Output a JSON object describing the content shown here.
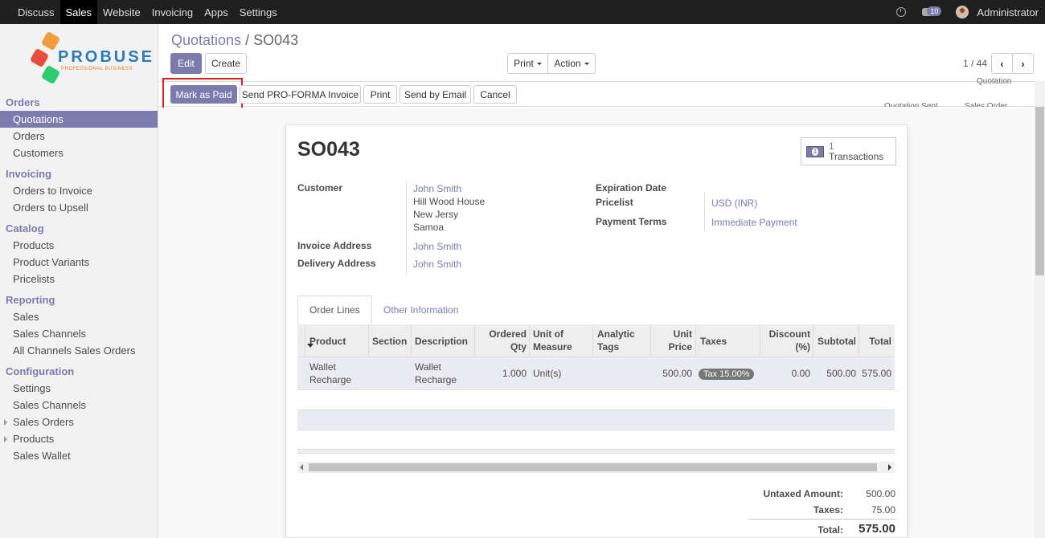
{
  "topbar": {
    "menu": [
      "Discuss",
      "Sales",
      "Website",
      "Invoicing",
      "Apps",
      "Settings"
    ],
    "active_index": 1,
    "chat_count": "10",
    "user": "Administrator"
  },
  "logo": {
    "brand": "PROBUSE",
    "tagline": "PROFESSIONAL BUSINESS"
  },
  "sidebar": {
    "orders_section": "Orders",
    "quotations": "Quotations",
    "orders": "Orders",
    "customers": "Customers",
    "invoicing_section": "Invoicing",
    "orders_to_invoice": "Orders to Invoice",
    "orders_to_upsell": "Orders to Upsell",
    "catalog_section": "Catalog",
    "products": "Products",
    "product_variants": "Product Variants",
    "pricelists": "Pricelists",
    "reporting_section": "Reporting",
    "sales": "Sales",
    "sales_channels": "Sales Channels",
    "all_channels": "All Channels Sales Orders",
    "config_section": "Configuration",
    "settings": "Settings",
    "cfg_sales_channels": "Sales Channels",
    "cfg_sales_orders": "Sales Orders",
    "cfg_products": "Products",
    "sales_wallet": "Sales Wallet"
  },
  "breadcrumb": {
    "parent": "Quotations",
    "separator": "/",
    "current": "SO043"
  },
  "buttons": {
    "edit": "Edit",
    "create": "Create",
    "print_dd": "Print",
    "action_dd": "Action",
    "mark_paid": "Mark as Paid",
    "proforma": "Send PRO-FORMA Invoice",
    "print": "Print",
    "send_email": "Send by Email",
    "cancel": "Cancel"
  },
  "pager": {
    "text": "1 / 44"
  },
  "stages": {
    "quotation": "Quotation",
    "quotation_sent": "Quotation Sent",
    "sales_order": "Sales Order"
  },
  "form": {
    "name": "SO043",
    "transactions_count": "1",
    "transactions_label": "Transactions",
    "customer_label": "Customer",
    "customer_name": "John Smith",
    "customer_addr1": "Hill Wood House",
    "customer_addr2": "New Jersy",
    "customer_addr3": "Samoa",
    "invoice_addr_label": "Invoice Address",
    "invoice_addr": "John Smith",
    "delivery_addr_label": "Delivery Address",
    "delivery_addr": "John Smith",
    "expiration_label": "Expiration Date",
    "pricelist_label": "Pricelist",
    "pricelist": "USD (INR)",
    "payment_terms_label": "Payment Terms",
    "payment_terms": "Immediate Payment"
  },
  "tabs": {
    "order_lines": "Order Lines",
    "other_info": "Other Information"
  },
  "table": {
    "h_product": "Product",
    "h_section": "Section",
    "h_description": "Description",
    "h_ordered_1": "Ordered",
    "h_ordered_2": "Qty",
    "h_uom_1": "Unit of",
    "h_uom_2": "Measure",
    "h_analytic_1": "Analytic",
    "h_analytic_2": "Tags",
    "h_unit_1": "Unit",
    "h_unit_2": "Price",
    "h_taxes": "Taxes",
    "h_discount_1": "Discount",
    "h_discount_2": "(%)",
    "h_subtotal": "Subtotal",
    "h_total": "Total",
    "rows": [
      {
        "product_1": "Wallet",
        "product_2": "Recharge",
        "description_1": "Wallet",
        "description_2": "Recharge",
        "qty": "1.000",
        "uom": "Unit(s)",
        "unit_price": "500.00",
        "tax": "Tax 15.00%",
        "discount": "0.00",
        "subtotal": "500.00",
        "total": "575.00"
      }
    ]
  },
  "totals": {
    "untaxed_label": "Untaxed Amount:",
    "untaxed": "500.00",
    "taxes_label": "Taxes:",
    "taxes": "75.00",
    "total_label": "Total:",
    "total": "575.00"
  },
  "colors": {
    "accent": "#7c7bad",
    "highlight": "#e02020",
    "topbar": "#1f1f1f"
  }
}
